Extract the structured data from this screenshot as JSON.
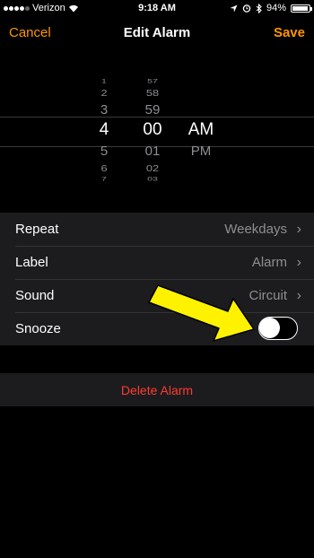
{
  "status": {
    "carrier": "Verizon",
    "time": "9:18 AM",
    "battery": "94%",
    "battery_level": 0.94
  },
  "nav": {
    "cancel": "Cancel",
    "title": "Edit Alarm",
    "save": "Save"
  },
  "picker": {
    "hours": [
      "1",
      "2",
      "3",
      "4",
      "5",
      "6",
      "7"
    ],
    "minutes": [
      "57",
      "58",
      "59",
      "00",
      "01",
      "02",
      "03"
    ],
    "periods": [
      "AM",
      "PM"
    ],
    "selected": {
      "hour": "4",
      "minute": "00",
      "period": "AM"
    }
  },
  "settings": {
    "repeat": {
      "label": "Repeat",
      "value": "Weekdays"
    },
    "label": {
      "label": "Label",
      "value": "Alarm"
    },
    "sound": {
      "label": "Sound",
      "value": "Circuit"
    },
    "snooze": {
      "label": "Snooze",
      "on": false
    }
  },
  "delete": "Delete Alarm",
  "colors": {
    "accent": "#ff9500",
    "destructive": "#ff3b30",
    "annotation_arrow": "#fff200"
  },
  "icons": [
    "wifi-icon",
    "location-icon",
    "alarm-clock-icon",
    "bluetooth-icon",
    "battery-icon",
    "chevron-right-icon"
  ]
}
